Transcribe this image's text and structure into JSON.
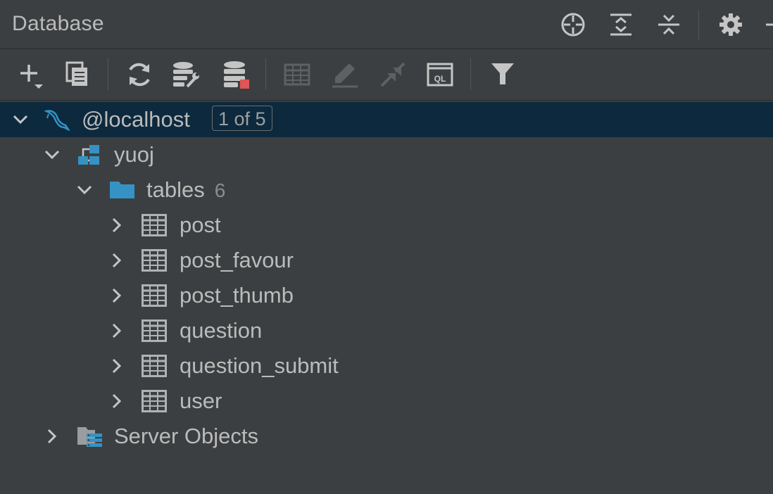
{
  "panel": {
    "title": "Database",
    "header_icons": [
      "crosshair-icon",
      "expand-all-icon",
      "collapse-all-icon",
      "gear-icon",
      "minimize-icon"
    ]
  },
  "toolbar": {
    "tools": [
      "add-icon",
      "copy-icon",
      "refresh-icon",
      "data-source-properties-icon",
      "database-stop-icon",
      "table-view-icon",
      "edit-icon",
      "jump-icon",
      "query-console-icon",
      "filter-icon"
    ]
  },
  "tree": {
    "host": {
      "label": "@localhost",
      "badge": "1 of 5"
    },
    "schema": {
      "label": "yuoj"
    },
    "tables_folder": {
      "label": "tables",
      "count": "6"
    },
    "tables": [
      {
        "label": "post"
      },
      {
        "label": "post_favour"
      },
      {
        "label": "post_thumb"
      },
      {
        "label": "question"
      },
      {
        "label": "question_submit"
      },
      {
        "label": "user"
      }
    ],
    "server_objects": {
      "label": "Server Objects"
    }
  },
  "colors": {
    "background": "#3c3f41",
    "selection": "#0d293e",
    "text": "#bbbbbb",
    "accent_blue": "#3592c4",
    "stop_red": "#e05555"
  }
}
